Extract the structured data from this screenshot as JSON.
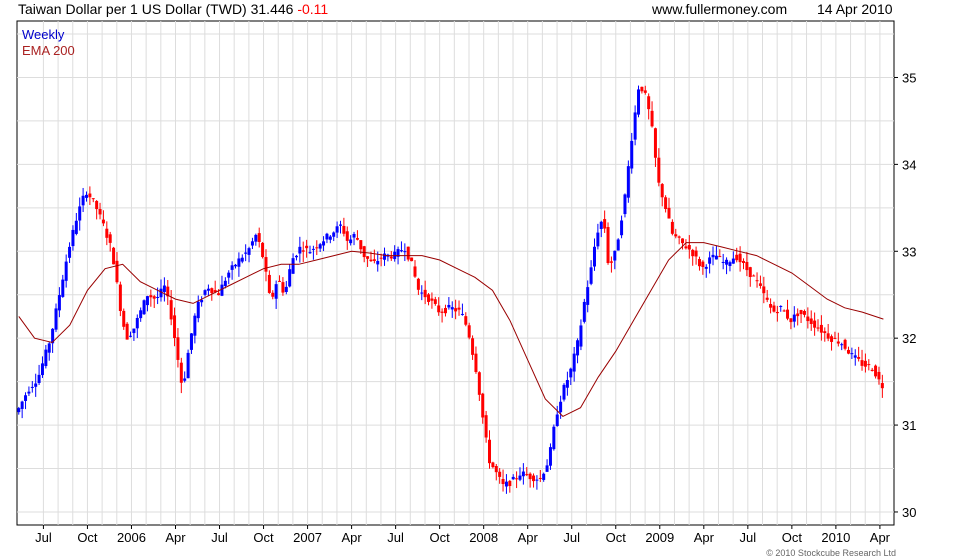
{
  "header": {
    "title": "Taiwan Dollar per 1 US Dollar (TWD)",
    "price": "31.446",
    "change": "-0.11",
    "site": "www.fullermoney.com",
    "date": "14 Apr 2010"
  },
  "legend": {
    "series_label": "Weekly",
    "ema_label": "EMA 200"
  },
  "copyright": "© 2010 Stockcube Research Ltd",
  "colors": {
    "up": "#0000ff",
    "down": "#ff0000",
    "ema": "#990000",
    "grid": "#dddddd",
    "axis": "#000000"
  },
  "chart_data": {
    "type": "line",
    "title": "Taiwan Dollar per 1 US Dollar (TWD)",
    "xlabel": "",
    "ylabel": "",
    "ylim": [
      29.85,
      35.65
    ],
    "xlim": [
      2005.35,
      2010.33
    ],
    "grid": true,
    "y_ticks": [
      30,
      31,
      32,
      33,
      34,
      35
    ],
    "x_ticks": [
      {
        "label": "Jul",
        "t": 2005.5
      },
      {
        "label": "Oct",
        "t": 2005.75
      },
      {
        "label": "2006",
        "t": 2006.0
      },
      {
        "label": "Apr",
        "t": 2006.25
      },
      {
        "label": "Jul",
        "t": 2006.5
      },
      {
        "label": "Oct",
        "t": 2006.75
      },
      {
        "label": "2007",
        "t": 2007.0
      },
      {
        "label": "Apr",
        "t": 2007.25
      },
      {
        "label": "Jul",
        "t": 2007.5
      },
      {
        "label": "Oct",
        "t": 2007.75
      },
      {
        "label": "2008",
        "t": 2008.0
      },
      {
        "label": "Apr",
        "t": 2008.25
      },
      {
        "label": "Jul",
        "t": 2008.5
      },
      {
        "label": "Oct",
        "t": 2008.75
      },
      {
        "label": "2009",
        "t": 2009.0
      },
      {
        "label": "Apr",
        "t": 2009.25
      },
      {
        "label": "Jul",
        "t": 2009.5
      },
      {
        "label": "Oct",
        "t": 2009.75
      },
      {
        "label": "2010",
        "t": 2010.0
      },
      {
        "label": "Apr",
        "t": 2010.25
      }
    ],
    "price_path": [
      [
        2005.36,
        31.15
      ],
      [
        2005.42,
        31.4
      ],
      [
        2005.48,
        31.55
      ],
      [
        2005.55,
        32.0
      ],
      [
        2005.6,
        32.5
      ],
      [
        2005.65,
        33.0
      ],
      [
        2005.7,
        33.4
      ],
      [
        2005.75,
        33.7
      ],
      [
        2005.8,
        33.55
      ],
      [
        2005.85,
        33.3
      ],
      [
        2005.9,
        33.0
      ],
      [
        2005.95,
        32.3
      ],
      [
        2005.98,
        32.0
      ],
      [
        2006.02,
        32.1
      ],
      [
        2006.06,
        32.3
      ],
      [
        2006.1,
        32.5
      ],
      [
        2006.15,
        32.45
      ],
      [
        2006.2,
        32.6
      ],
      [
        2006.24,
        32.2
      ],
      [
        2006.27,
        31.8
      ],
      [
        2006.3,
        31.4
      ],
      [
        2006.34,
        31.95
      ],
      [
        2006.38,
        32.35
      ],
      [
        2006.44,
        32.6
      ],
      [
        2006.5,
        32.5
      ],
      [
        2006.56,
        32.75
      ],
      [
        2006.62,
        32.9
      ],
      [
        2006.67,
        33.0
      ],
      [
        2006.72,
        33.2
      ],
      [
        2006.76,
        32.9
      ],
      [
        2006.8,
        32.4
      ],
      [
        2006.84,
        32.7
      ],
      [
        2006.88,
        32.5
      ],
      [
        2006.92,
        32.9
      ],
      [
        2006.97,
        33.05
      ],
      [
        2007.02,
        33.0
      ],
      [
        2007.08,
        33.1
      ],
      [
        2007.14,
        33.2
      ],
      [
        2007.2,
        33.3
      ],
      [
        2007.24,
        33.1
      ],
      [
        2007.28,
        33.2
      ],
      [
        2007.33,
        32.95
      ],
      [
        2007.38,
        32.85
      ],
      [
        2007.44,
        32.95
      ],
      [
        2007.5,
        32.95
      ],
      [
        2007.56,
        33.05
      ],
      [
        2007.6,
        32.85
      ],
      [
        2007.64,
        32.55
      ],
      [
        2007.7,
        32.45
      ],
      [
        2007.76,
        32.3
      ],
      [
        2007.82,
        32.35
      ],
      [
        2007.88,
        32.3
      ],
      [
        2007.92,
        32.1
      ],
      [
        2007.97,
        31.6
      ],
      [
        2008.01,
        31.0
      ],
      [
        2008.04,
        30.6
      ],
      [
        2008.08,
        30.45
      ],
      [
        2008.12,
        30.3
      ],
      [
        2008.17,
        30.35
      ],
      [
        2008.22,
        30.45
      ],
      [
        2008.28,
        30.4
      ],
      [
        2008.33,
        30.38
      ],
      [
        2008.38,
        30.6
      ],
      [
        2008.42,
        31.1
      ],
      [
        2008.46,
        31.4
      ],
      [
        2008.5,
        31.6
      ],
      [
        2008.55,
        32.0
      ],
      [
        2008.58,
        32.4
      ],
      [
        2008.62,
        32.8
      ],
      [
        2008.65,
        33.2
      ],
      [
        2008.69,
        33.4
      ],
      [
        2008.72,
        32.8
      ],
      [
        2008.76,
        33.0
      ],
      [
        2008.81,
        33.6
      ],
      [
        2008.85,
        34.3
      ],
      [
        2008.89,
        34.9
      ],
      [
        2008.92,
        34.85
      ],
      [
        2008.96,
        34.5
      ],
      [
        2009.0,
        33.8
      ],
      [
        2009.03,
        33.6
      ],
      [
        2009.08,
        33.2
      ],
      [
        2009.13,
        33.1
      ],
      [
        2009.19,
        33.0
      ],
      [
        2009.25,
        32.8
      ],
      [
        2009.29,
        32.9
      ],
      [
        2009.33,
        32.95
      ],
      [
        2009.38,
        32.85
      ],
      [
        2009.44,
        32.95
      ],
      [
        2009.5,
        32.8
      ],
      [
        2009.56,
        32.65
      ],
      [
        2009.6,
        32.5
      ],
      [
        2009.65,
        32.3
      ],
      [
        2009.7,
        32.35
      ],
      [
        2009.75,
        32.2
      ],
      [
        2009.8,
        32.3
      ],
      [
        2009.86,
        32.2
      ],
      [
        2009.92,
        32.1
      ],
      [
        2009.98,
        32.0
      ],
      [
        2010.04,
        31.95
      ],
      [
        2010.1,
        31.8
      ],
      [
        2010.16,
        31.7
      ],
      [
        2010.22,
        31.65
      ],
      [
        2010.27,
        31.45
      ]
    ],
    "series": [
      {
        "name": "EMA 200",
        "x": [
          2005.36,
          2005.45,
          2005.55,
          2005.65,
          2005.75,
          2005.85,
          2005.95,
          2006.05,
          2006.15,
          2006.25,
          2006.35,
          2006.45,
          2006.55,
          2006.65,
          2006.75,
          2006.85,
          2006.95,
          2007.05,
          2007.15,
          2007.25,
          2007.35,
          2007.45,
          2007.55,
          2007.65,
          2007.75,
          2007.85,
          2007.95,
          2008.05,
          2008.15,
          2008.25,
          2008.35,
          2008.45,
          2008.55,
          2008.65,
          2008.75,
          2008.85,
          2008.95,
          2009.05,
          2009.15,
          2009.25,
          2009.35,
          2009.45,
          2009.55,
          2009.65,
          2009.75,
          2009.85,
          2009.95,
          2010.05,
          2010.15,
          2010.27
        ],
        "values": [
          32.25,
          32.0,
          31.95,
          32.15,
          32.55,
          32.8,
          32.85,
          32.65,
          32.55,
          32.45,
          32.4,
          32.5,
          32.6,
          32.7,
          32.8,
          32.85,
          32.85,
          32.9,
          32.95,
          33.0,
          32.98,
          32.95,
          32.95,
          32.95,
          32.9,
          32.8,
          32.7,
          32.55,
          32.2,
          31.75,
          31.3,
          31.1,
          31.2,
          31.55,
          31.85,
          32.2,
          32.55,
          32.9,
          33.1,
          33.1,
          33.05,
          33.0,
          32.95,
          32.85,
          32.75,
          32.6,
          32.45,
          32.35,
          32.3,
          32.22
        ]
      }
    ]
  }
}
